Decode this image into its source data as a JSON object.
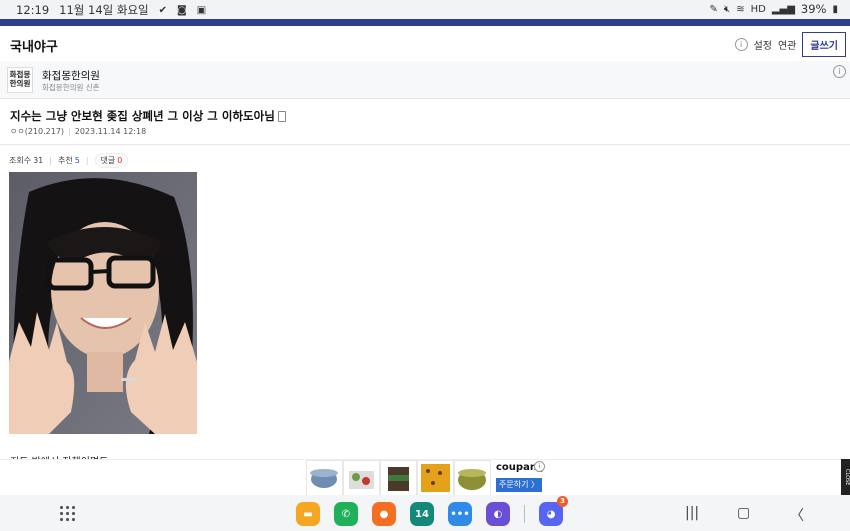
{
  "status_bar": {
    "time": "12:19",
    "date": "11월 14일 화요일",
    "battery": "39%",
    "network": "HD"
  },
  "board": {
    "title": "국내야구",
    "settings_label": "설정",
    "related_label": "연관",
    "write_label": "글쓰기"
  },
  "sponsor": {
    "logo_text": "화접몽\n한의원",
    "name": "화접몽한의원",
    "subtitle": "화접몽한의원 신촌"
  },
  "post": {
    "title": "지수는 그냥 안보현 좆집 상폐년 그 이상 그 이하도아님",
    "author": "ㅇㅇ(210.217)",
    "datetime": "2023.11.14 12:18",
    "views_label": "조회수",
    "views": "31",
    "likes_label": "추천",
    "likes": "5",
    "comments_label": "댓글",
    "comments": "0",
    "body_first_line": "지도 밖에서 잔챙이면도"
  },
  "ad": {
    "brand": "coupang",
    "cta": "주문하기 〉",
    "close_label": "CLOSE"
  },
  "dock": {
    "apps": [
      {
        "name": "folder",
        "color": "#f5a623",
        "glyph": "▬"
      },
      {
        "name": "phone",
        "color": "#1fb15a",
        "glyph": "✆"
      },
      {
        "name": "contacts",
        "color": "#f37021",
        "glyph": "●"
      },
      {
        "name": "calendar",
        "color": "#13897a",
        "glyph": "14"
      },
      {
        "name": "messages",
        "color": "#2f8ae8",
        "glyph": "•••"
      },
      {
        "name": "internet",
        "color": "#6a4fd6",
        "glyph": "◐"
      },
      {
        "name": "discord",
        "color": "#5865f2",
        "glyph": "◕",
        "badge": "3"
      }
    ]
  }
}
